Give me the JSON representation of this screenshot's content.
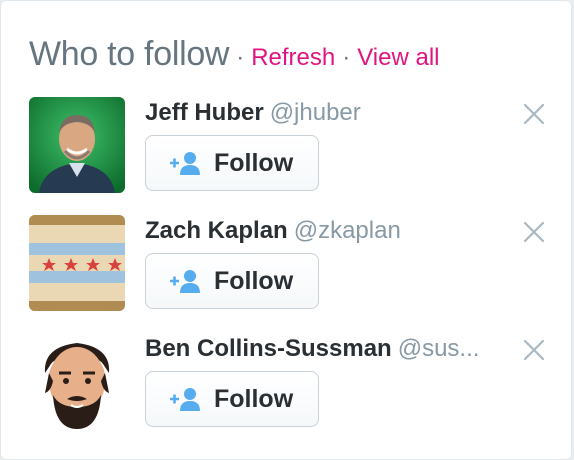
{
  "widget": {
    "title": "Who to follow",
    "separator": "·",
    "refresh_label": "Refresh",
    "view_all_label": "View all"
  },
  "suggestions": [
    {
      "name": "Jeff Huber",
      "handle": "@jhuber",
      "follow_label": "Follow"
    },
    {
      "name": "Zach Kaplan",
      "handle": "@zkaplan",
      "follow_label": "Follow"
    },
    {
      "name": "Ben Collins-Sussman",
      "handle": "@sus...",
      "follow_label": "Follow"
    }
  ],
  "icons": {
    "dismiss": "close-icon",
    "follow": "add-user-icon"
  },
  "colors": {
    "link": "#e0147f",
    "title": "#66757f",
    "handle": "#8899a6",
    "name": "#292f33",
    "follow_icon": "#55acee"
  }
}
